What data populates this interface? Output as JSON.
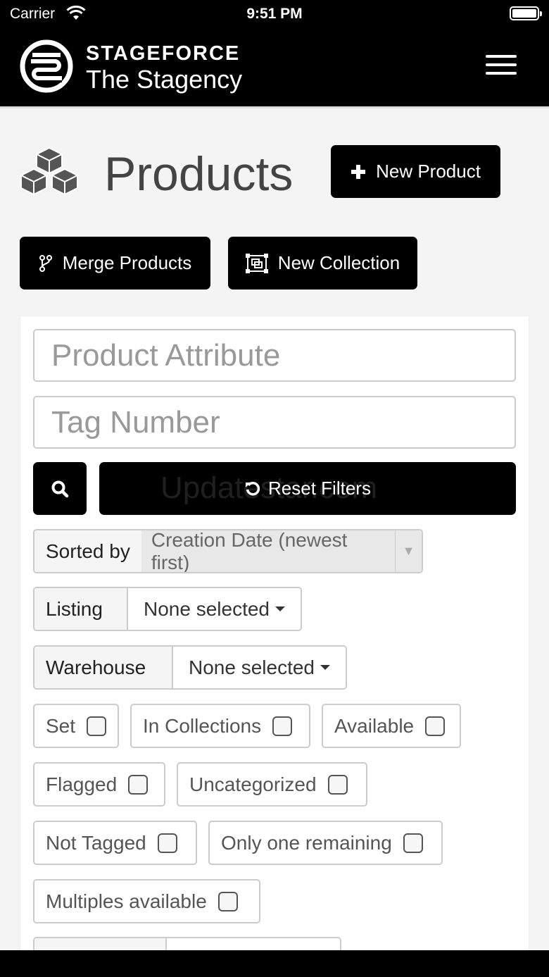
{
  "status_bar": {
    "carrier": "Carrier",
    "time": "9:51 PM"
  },
  "navbar": {
    "brand_top": "STAGEFORCE",
    "brand_name": "The Stagency"
  },
  "header": {
    "title": "Products",
    "new_product_label": "New Product"
  },
  "actions": {
    "merge_label": "Merge Products",
    "new_collection_label": "New Collection"
  },
  "filters": {
    "attribute_placeholder": "Product Attribute",
    "tag_placeholder": "Tag Number",
    "reset_label": "Reset Filters",
    "watermark": "Updatestar.com",
    "sorted_by_label": "Sorted by",
    "sorted_by_value": "Creation Date (newest first)",
    "listing_label": "Listing",
    "listing_value": "None selected",
    "warehouse_label": "Warehouse",
    "warehouse_value": "None selected",
    "checkboxes": [
      {
        "label": "Set",
        "checked": false
      },
      {
        "label": "In Collections",
        "checked": false
      },
      {
        "label": "Available",
        "checked": false
      },
      {
        "label": "Flagged",
        "checked": false
      },
      {
        "label": "Uncategorized",
        "checked": false
      },
      {
        "label": "Not Tagged",
        "checked": false
      },
      {
        "label": "Only one remaining",
        "checked": false
      },
      {
        "label": "Multiples available",
        "checked": false
      }
    ]
  },
  "icons": {
    "logo": "stageforce-logo-icon",
    "menu": "hamburger-menu-icon",
    "products": "cubes-icon",
    "plus": "plus-icon",
    "merge": "merge-branch-icon",
    "collection": "object-group-icon",
    "search": "search-icon",
    "reset": "undo-icon"
  }
}
